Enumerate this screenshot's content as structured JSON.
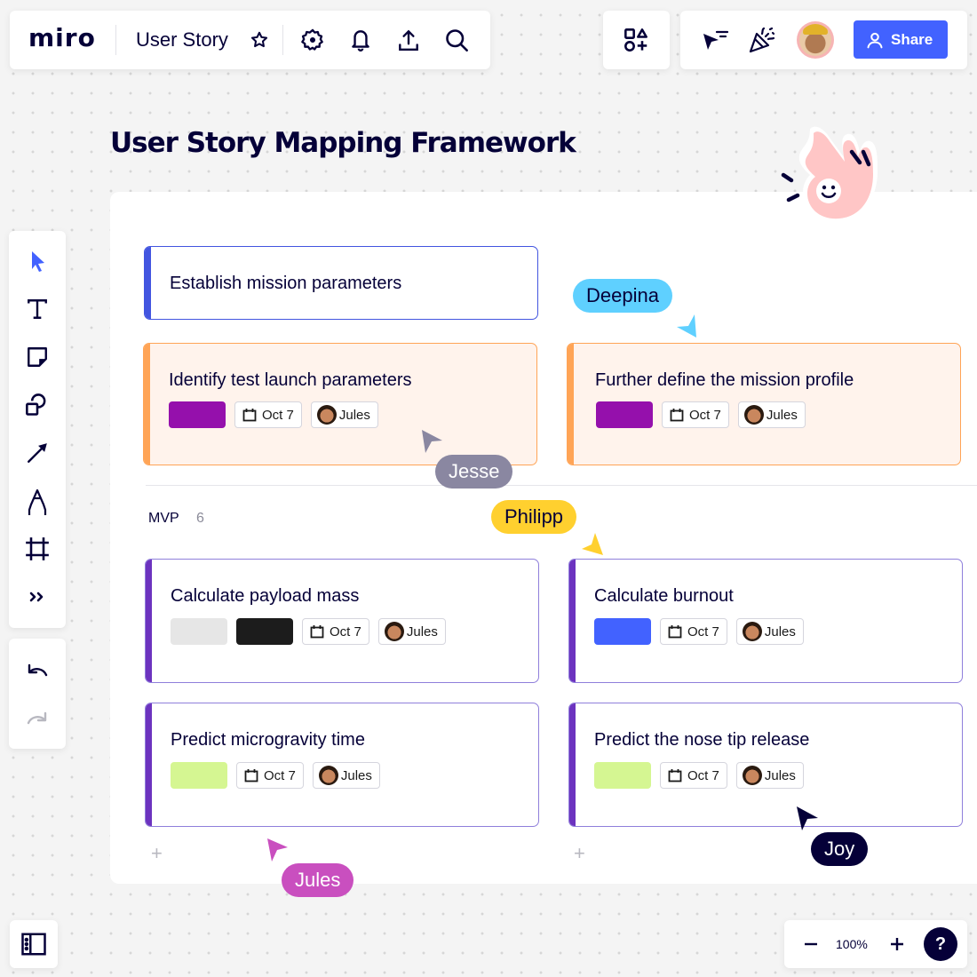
{
  "app": {
    "logo": "miro",
    "board_title": "User Story",
    "share_label": "Share",
    "zoom_level": "100%",
    "help_label": "?"
  },
  "topbar": {
    "icons": [
      "star-icon",
      "settings-gear-icon",
      "notifications-bell-icon",
      "export-upload-icon",
      "search-icon"
    ],
    "right_icons": [
      "apps-shapes-icon",
      "cursor-filter-icon",
      "celebrate-party-popper-icon",
      "user-avatar",
      "share-person-icon"
    ]
  },
  "toolbar": {
    "tools": [
      "select-cursor-icon",
      "text-icon",
      "sticky-note-icon",
      "shapes-icon",
      "connection-arrow-icon",
      "pen-icon",
      "frame-icon",
      "more-tools-icon"
    ],
    "active_tool": "select-cursor-icon",
    "history": [
      "undo-icon",
      "redo-icon"
    ]
  },
  "board": {
    "title": "User Story Mapping Framework",
    "activity_card": {
      "title": "Establish mission parameters",
      "accent": "#4255e0"
    },
    "step_cards": [
      {
        "title": "Identify test launch parameters",
        "tags": [
          "#9510ac"
        ],
        "date": "Oct 7",
        "assignee": "Jules"
      },
      {
        "title": "Further define the mission profile",
        "tags": [
          "#9510ac"
        ],
        "date": "Oct 7",
        "assignee": "Jules"
      }
    ],
    "release": {
      "label": "MVP",
      "count": "6"
    },
    "story_cards": [
      {
        "title": "Calculate payload mass",
        "tags": [
          "#e6e6e6",
          "#1c1c1c"
        ],
        "date": "Oct 7",
        "assignee": "Jules"
      },
      {
        "title": "Calculate burnout",
        "tags": [
          "#4262ff"
        ],
        "date": "Oct 7",
        "assignee": "Jules"
      },
      {
        "title": "Predict microgravity time",
        "tags": [
          "#d5f692"
        ],
        "date": "Oct 7",
        "assignee": "Jules"
      },
      {
        "title": "Predict the nose tip release",
        "tags": [
          "#d5f692"
        ],
        "date": "Oct 7",
        "assignee": "Jules"
      }
    ]
  },
  "collaborators": [
    {
      "name": "Deepina",
      "color": "#5fd0ff",
      "text_color": "#050038"
    },
    {
      "name": "Jesse",
      "color": "#8a87a1",
      "text_color": "#ffffff"
    },
    {
      "name": "Philipp",
      "color": "#ffd02f",
      "text_color": "#050038"
    },
    {
      "name": "Jules",
      "color": "#c94fbf",
      "text_color": "#ffffff"
    },
    {
      "name": "Joy",
      "color": "#050038",
      "text_color": "#ffffff"
    }
  ]
}
